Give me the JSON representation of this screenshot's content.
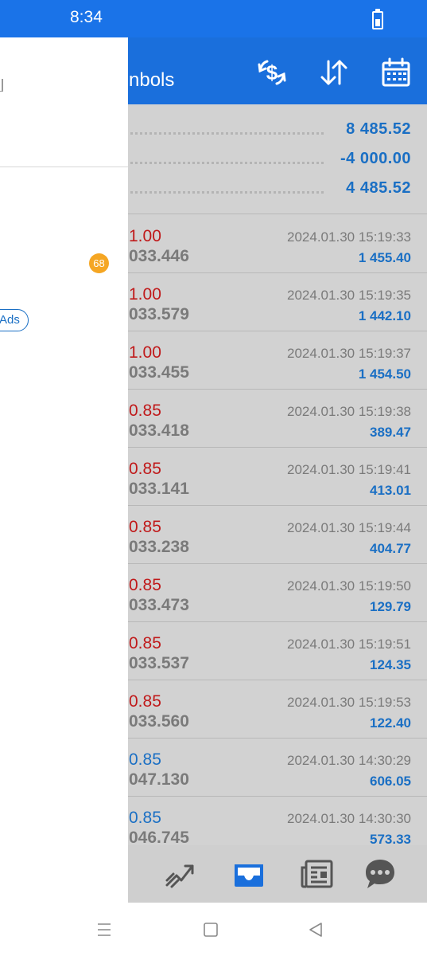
{
  "status_bar": {
    "time": "8:34",
    "battery_icon": "battery-icon"
  },
  "header": {
    "title": "nbols",
    "icons": [
      "currency-exchange-icon",
      "sort-icon",
      "calendar-icon"
    ],
    "color": "#1a6fdc"
  },
  "summary": [
    "8 485.52",
    "-4 000.00",
    "4 485.52"
  ],
  "deals": [
    {
      "volume": "1.00",
      "type": "sell",
      "price": "033.446",
      "date": "2024.01.30 15:19:33",
      "profit": "1 455.40"
    },
    {
      "volume": "1.00",
      "type": "sell",
      "price": "033.579",
      "date": "2024.01.30 15:19:35",
      "profit": "1 442.10"
    },
    {
      "volume": "1.00",
      "type": "sell",
      "price": "033.455",
      "date": "2024.01.30 15:19:37",
      "profit": "1 454.50"
    },
    {
      "volume": "0.85",
      "type": "sell",
      "price": "033.418",
      "date": "2024.01.30 15:19:38",
      "profit": "389.47"
    },
    {
      "volume": "0.85",
      "type": "sell",
      "price": "033.141",
      "date": "2024.01.30 15:19:41",
      "profit": "413.01"
    },
    {
      "volume": "0.85",
      "type": "sell",
      "price": "033.238",
      "date": "2024.01.30 15:19:44",
      "profit": "404.77"
    },
    {
      "volume": "0.85",
      "type": "sell",
      "price": "033.473",
      "date": "2024.01.30 15:19:50",
      "profit": "129.79"
    },
    {
      "volume": "0.85",
      "type": "sell",
      "price": "033.537",
      "date": "2024.01.30 15:19:51",
      "profit": "124.35"
    },
    {
      "volume": "0.85",
      "type": "sell",
      "price": "033.560",
      "date": "2024.01.30 15:19:53",
      "profit": "122.40"
    },
    {
      "volume": "0.85",
      "type": "buy",
      "price": "047.130",
      "date": "2024.01.30 14:30:29",
      "profit": "606.05"
    },
    {
      "volume": "0.85",
      "type": "buy",
      "price": "046.745",
      "date": "2024.01.30 14:30:30",
      "profit": "573.33"
    }
  ],
  "bottom_nav": [
    {
      "icon": "trade-chart-icon",
      "active": false
    },
    {
      "icon": "history-inbox-icon",
      "active": true
    },
    {
      "icon": "news-icon",
      "active": false
    },
    {
      "icon": "chat-icon",
      "active": false
    }
  ],
  "drawer": {
    "badge": "68",
    "ads_label": "Ads"
  },
  "colors": {
    "sell": "#c0191a",
    "buy": "#1a6fc4",
    "accent": "#1a73e8"
  }
}
